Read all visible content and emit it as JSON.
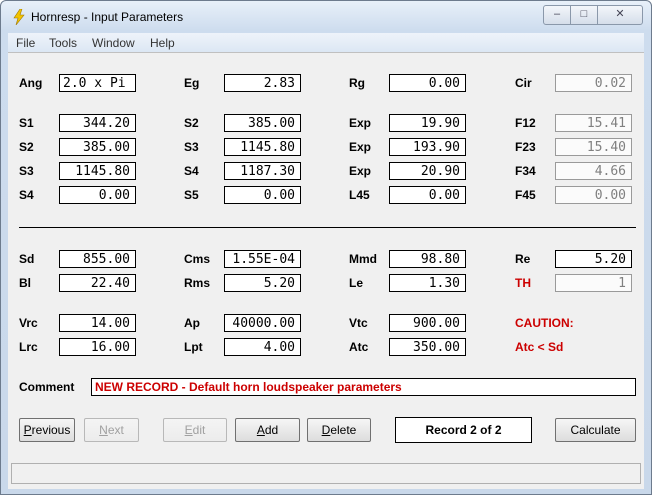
{
  "window": {
    "title": "Hornresp - Input Parameters",
    "min_glyph": "–",
    "max_glyph": "□",
    "close_glyph": "✕"
  },
  "menu": [
    "File",
    "Tools",
    "Window",
    "Help"
  ],
  "fields": {
    "ang": {
      "label": "Ang",
      "value": "2.0 x Pi"
    },
    "eg": {
      "label": "Eg",
      "value": "2.83"
    },
    "rg": {
      "label": "Rg",
      "value": "0.00"
    },
    "cir": {
      "label": "Cir",
      "value": "0.02"
    },
    "s1": {
      "label": "S1",
      "value": "344.20"
    },
    "s2a": {
      "label": "S2",
      "value": "385.00"
    },
    "exp1": {
      "label": "Exp",
      "value": "19.90"
    },
    "f12": {
      "label": "F12",
      "value": "15.41"
    },
    "s2b": {
      "label": "S2",
      "value": "385.00"
    },
    "s3a": {
      "label": "S3",
      "value": "1145.80"
    },
    "exp2": {
      "label": "Exp",
      "value": "193.90"
    },
    "f23": {
      "label": "F23",
      "value": "15.40"
    },
    "s3b": {
      "label": "S3",
      "value": "1145.80"
    },
    "s4a": {
      "label": "S4",
      "value": "1187.30"
    },
    "exp3": {
      "label": "Exp",
      "value": "20.90"
    },
    "f34": {
      "label": "F34",
      "value": "4.66"
    },
    "s4b": {
      "label": "S4",
      "value": "0.00"
    },
    "s5": {
      "label": "S5",
      "value": "0.00"
    },
    "l45": {
      "label": "L45",
      "value": "0.00"
    },
    "f45": {
      "label": "F45",
      "value": "0.00"
    },
    "sd": {
      "label": "Sd",
      "value": "855.00"
    },
    "cms": {
      "label": "Cms",
      "value": "1.55E-04"
    },
    "mmd": {
      "label": "Mmd",
      "value": "98.80"
    },
    "re": {
      "label": "Re",
      "value": "5.20"
    },
    "bl": {
      "label": "Bl",
      "value": "22.40"
    },
    "rms": {
      "label": "Rms",
      "value": "5.20"
    },
    "le": {
      "label": "Le",
      "value": "1.30"
    },
    "th": {
      "label": "TH",
      "value": "1"
    },
    "vrc": {
      "label": "Vrc",
      "value": "14.00"
    },
    "ap": {
      "label": "Ap",
      "value": "40000.00"
    },
    "vtc": {
      "label": "Vtc",
      "value": "900.00"
    },
    "lrc": {
      "label": "Lrc",
      "value": "16.00"
    },
    "lpt": {
      "label": "Lpt",
      "value": "4.00"
    },
    "atc": {
      "label": "Atc",
      "value": "350.00"
    }
  },
  "caution": {
    "title": "CAUTION:",
    "message": "Atc < Sd"
  },
  "comment": {
    "label": "Comment",
    "value": "NEW RECORD - Default horn loudspeaker parameters"
  },
  "buttons": {
    "previous": {
      "first": "P",
      "rest": "revious"
    },
    "next": {
      "first": "N",
      "rest": "ext"
    },
    "edit": {
      "first": "E",
      "rest": "dit"
    },
    "add": {
      "first": "A",
      "rest": "dd"
    },
    "delete": {
      "first": "D",
      "rest": "elete"
    },
    "calculate": "Calculate"
  },
  "record_counter": "Record 2 of 2"
}
